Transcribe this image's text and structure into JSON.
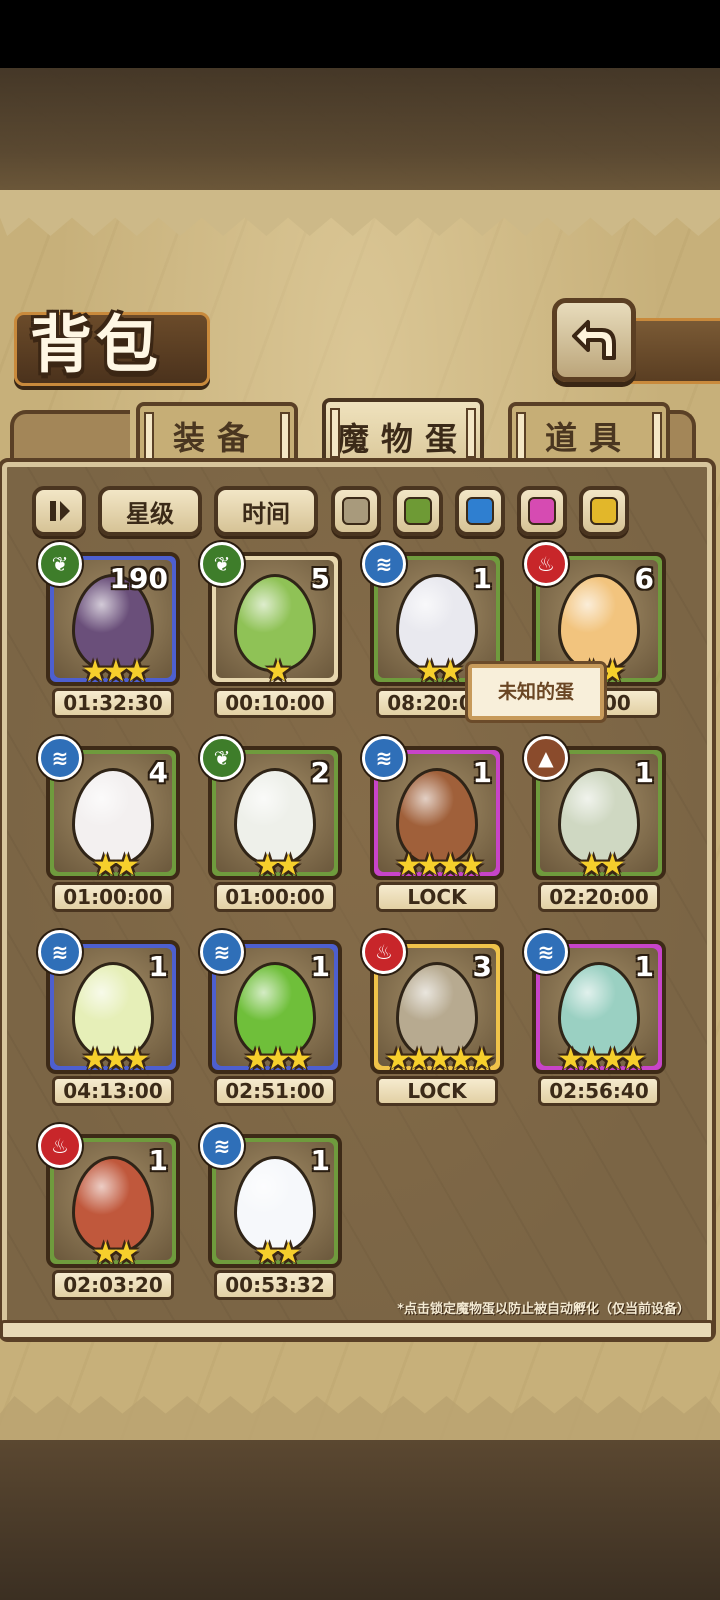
{
  "title": "背包",
  "tabs": [
    {
      "label": "装备",
      "active": false
    },
    {
      "label": "魔物蛋",
      "active": true
    },
    {
      "label": "道具",
      "active": false
    }
  ],
  "filters": {
    "sort_star": "星级",
    "sort_time": "时间",
    "colors": [
      "#a89a7c",
      "#6e9a35",
      "#2f7fd0",
      "#d64bb2",
      "#e2b72a"
    ]
  },
  "eggs": [
    {
      "element": "leaf",
      "count": "190",
      "stars": "★★★",
      "timer": "01:32:30",
      "rarity": "blue",
      "egg_color": "#6a4f7a"
    },
    {
      "element": "leaf",
      "count": "5",
      "stars": "★",
      "timer": "00:10:00",
      "rarity": "beige",
      "egg_color": "#8fc256"
    },
    {
      "element": "water",
      "count": "1",
      "stars": "★★",
      "timer": "08:20:00",
      "rarity": "green",
      "egg_color": "#e9e9ef"
    },
    {
      "element": "fire",
      "count": "6",
      "stars": "★★",
      "timer": "00:00",
      "rarity": "green",
      "egg_color": "#f2c47e"
    },
    {
      "element": "water",
      "count": "4",
      "stars": "★★",
      "timer": "01:00:00",
      "rarity": "green",
      "egg_color": "#f3f0f0"
    },
    {
      "element": "leaf",
      "count": "2",
      "stars": "★★",
      "timer": "01:00:00",
      "rarity": "green",
      "egg_color": "#eef0ea"
    },
    {
      "element": "water",
      "count": "1",
      "stars": "★★★★",
      "timer": "LOCK",
      "rarity": "purple",
      "egg_color": "#a0603a"
    },
    {
      "element": "earth",
      "count": "1",
      "stars": "★★",
      "timer": "02:20:00",
      "rarity": "green",
      "egg_color": "#cfd8c2"
    },
    {
      "element": "water",
      "count": "1",
      "stars": "★★★",
      "timer": "04:13:00",
      "rarity": "blue",
      "egg_color": "#e6efb8"
    },
    {
      "element": "water",
      "count": "1",
      "stars": "★★★",
      "timer": "02:51:00",
      "rarity": "blue",
      "egg_color": "#6fbf3a"
    },
    {
      "element": "fire",
      "count": "3",
      "stars": "★★★★★",
      "timer": "LOCK",
      "rarity": "gold",
      "egg_color": "#b7aa90"
    },
    {
      "element": "water",
      "count": "1",
      "stars": "★★★★",
      "timer": "02:56:40",
      "rarity": "purple",
      "egg_color": "#9ad0c2"
    },
    {
      "element": "fire",
      "count": "1",
      "stars": "★★",
      "timer": "02:03:20",
      "rarity": "green",
      "egg_color": "#c0583c"
    },
    {
      "element": "water",
      "count": "1",
      "stars": "★★",
      "timer": "00:53:32",
      "rarity": "green",
      "egg_color": "#f6f8fb"
    }
  ],
  "tooltip": "未知的蛋",
  "footnote": "*点击锁定魔物蛋以防止被自动孵化（仅当前设备）"
}
